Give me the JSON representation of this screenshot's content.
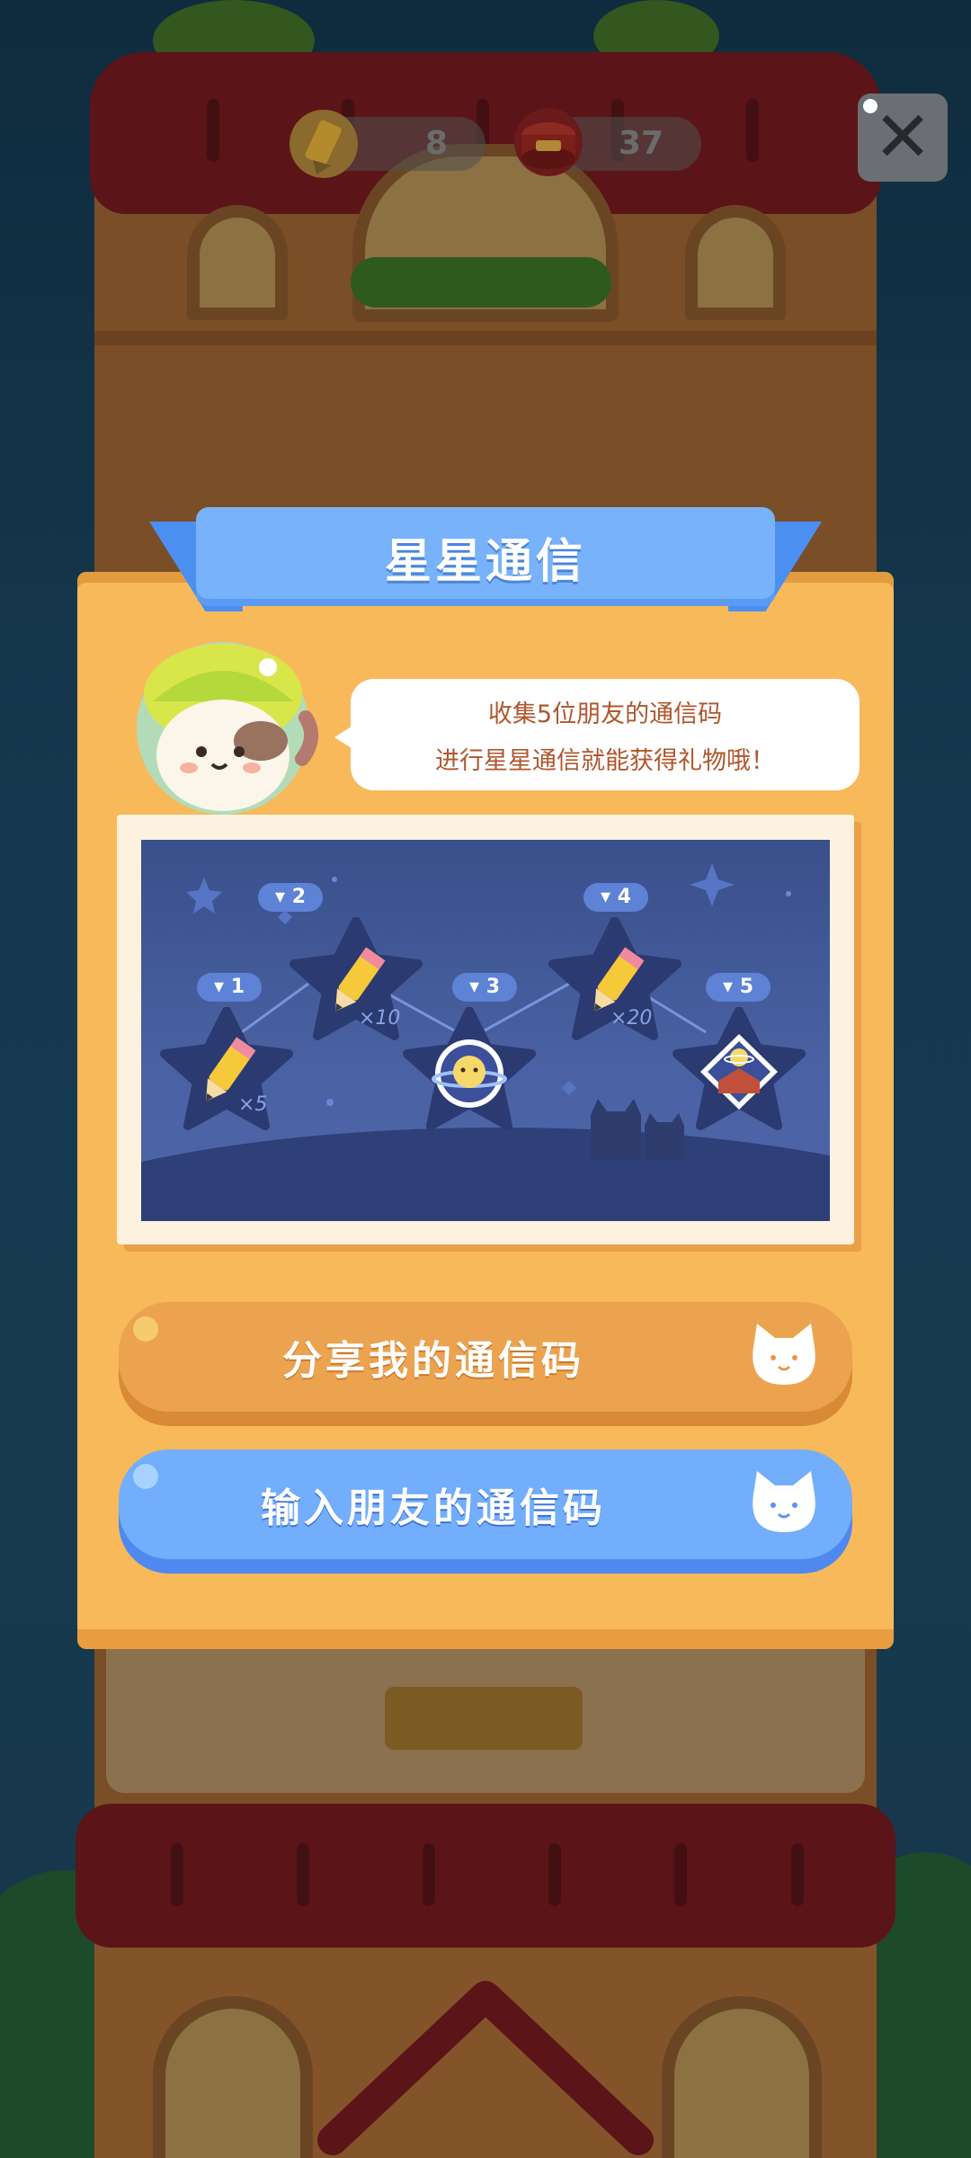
{
  "hud": {
    "pencil_count": "8",
    "can_count": "37",
    "close_icon": "close-icon"
  },
  "modal": {
    "title": "星星通信",
    "bubble_line1": "收集5位朋友的通信码",
    "bubble_line2": "进行星星通信就能获得礼物哦！",
    "nodes": [
      {
        "tag": "1",
        "reward": "pencil",
        "mult": "×5"
      },
      {
        "tag": "2",
        "reward": "pencil",
        "mult": "×10"
      },
      {
        "tag": "3",
        "reward": "cat-planet-badge",
        "mult": ""
      },
      {
        "tag": "4",
        "reward": "pencil",
        "mult": "×20"
      },
      {
        "tag": "5",
        "reward": "house-planet-badge",
        "mult": ""
      }
    ],
    "share_button": "分享我的通信码",
    "enter_button": "输入朋友的通信码"
  },
  "colors": {
    "modal_bg": "#f7b95a",
    "ribbon_blue": "#78b2fb",
    "share_orange": "#eca34f",
    "enter_blue": "#72aefc",
    "bubble_text": "#b0562d"
  }
}
